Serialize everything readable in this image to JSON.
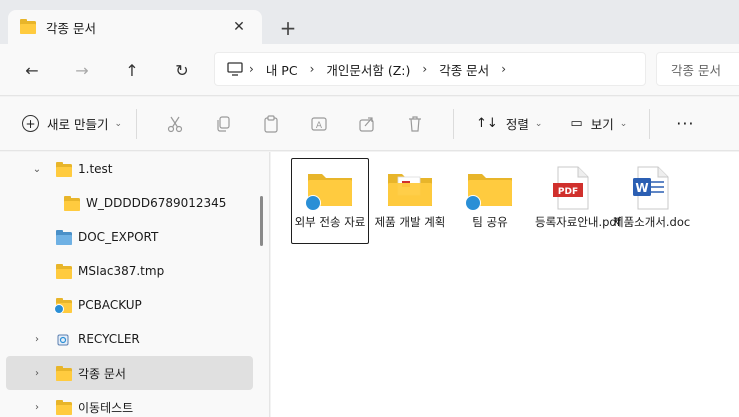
{
  "tab": {
    "title": "각종 문서",
    "close_glyph": "✕",
    "new_tab_glyph": "+"
  },
  "nav": {
    "back_glyph": "←",
    "forward_glyph": "→",
    "up_glyph": "↑",
    "refresh_glyph": "↻"
  },
  "address": {
    "crumbs": [
      "내 PC",
      "개인문서함 (Z:)",
      "각종 문서"
    ],
    "separator": "›",
    "search_placeholder": "각종 문서"
  },
  "toolbar": {
    "new_label": "새로 만들기",
    "sort_label": "정렬",
    "view_label": "보기",
    "more_glyph": "···",
    "caret": "⌄",
    "plus_glyph": "+",
    "sort_glyph": "↑↓",
    "view_glyph": "▭"
  },
  "sidebar": {
    "items": [
      {
        "label": "1.test",
        "chevron": "⌄"
      },
      {
        "label": "W_DDDDD6789012345"
      },
      {
        "label": "DOC_EXPORT"
      },
      {
        "label": "MSIac387.tmp"
      },
      {
        "label": "PCBACKUP"
      },
      {
        "label": "RECYCLER",
        "chevron": "›"
      },
      {
        "label": "각종 문서",
        "chevron": "›"
      },
      {
        "label": "이동테스트",
        "chevron": "›"
      }
    ]
  },
  "content": {
    "items": [
      {
        "label": "외부 전송 자료",
        "type": "shared-folder"
      },
      {
        "label": "제품 개발 계획",
        "type": "folder-with-file"
      },
      {
        "label": "팀 공유",
        "type": "shared-folder"
      },
      {
        "label": "등록자료안내.pdf",
        "type": "pdf",
        "badge": "PDF"
      },
      {
        "label": "제품소개서.doc",
        "type": "word",
        "badge": "W"
      }
    ]
  },
  "colors": {
    "folder_back": "#e8b52a",
    "folder_front": "#ffcb3f",
    "pdf_red": "#d0302c",
    "word_blue": "#2b5fb3",
    "share_blue": "#2a8fd6",
    "selection": "#e0e0e0"
  }
}
